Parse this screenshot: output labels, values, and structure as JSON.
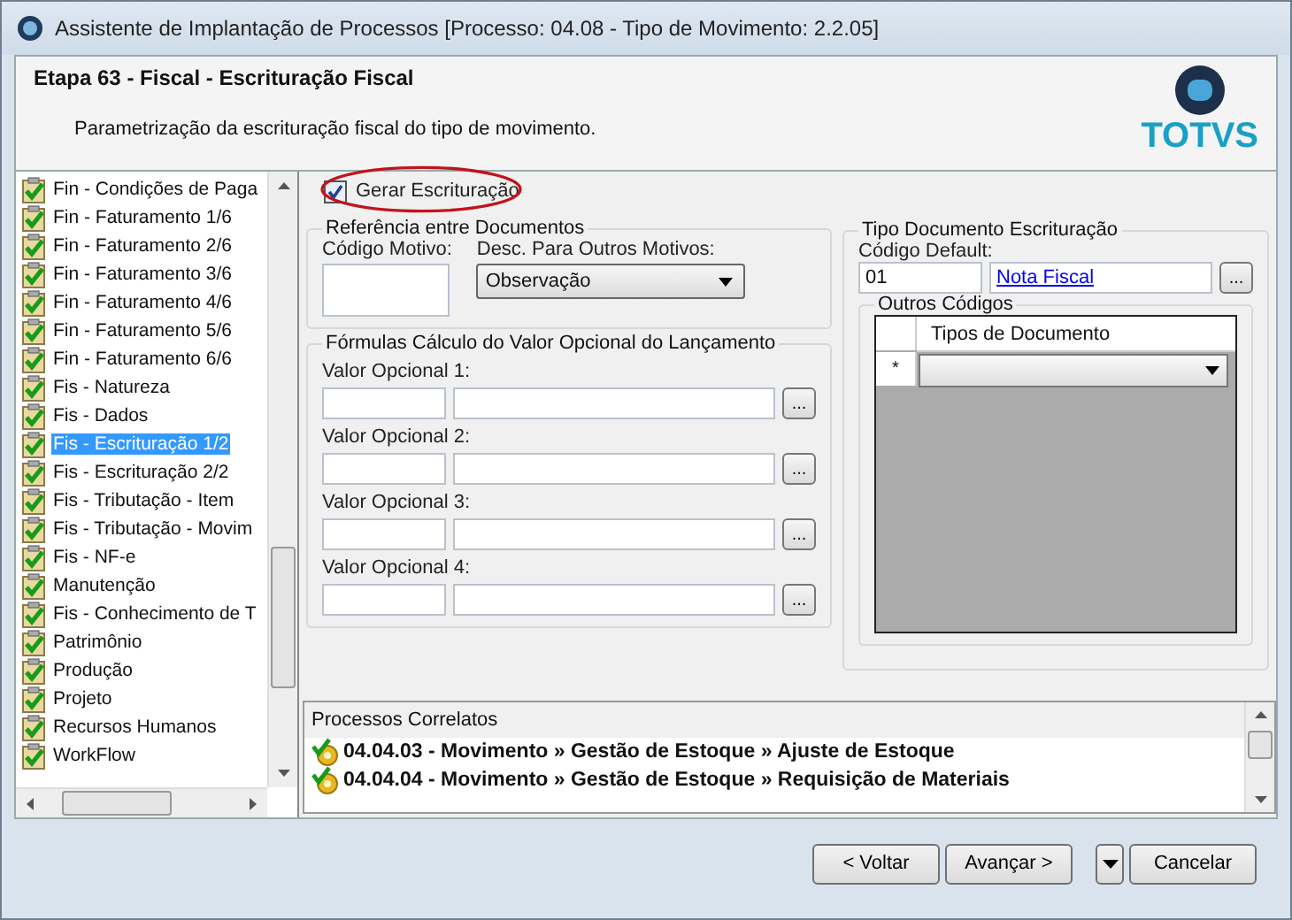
{
  "window": {
    "title": "Assistente de Implantação de Processos [Processo: 04.08 - Tipo de Movimento: 2.2.05]"
  },
  "header": {
    "step": "Etapa 63 - Fiscal - Escrituração Fiscal",
    "description": "Parametrização da escrituração fiscal do tipo de movimento.",
    "logo": "TOTVS"
  },
  "tree": {
    "items": [
      {
        "label": "Fin - Condições de Paga",
        "selected": false
      },
      {
        "label": "Fin - Faturamento 1/6",
        "selected": false
      },
      {
        "label": "Fin - Faturamento 2/6",
        "selected": false
      },
      {
        "label": "Fin - Faturamento 3/6",
        "selected": false
      },
      {
        "label": "Fin - Faturamento 4/6",
        "selected": false
      },
      {
        "label": "Fin - Faturamento 5/6",
        "selected": false
      },
      {
        "label": "Fin - Faturamento 6/6",
        "selected": false
      },
      {
        "label": "Fis - Natureza",
        "selected": false
      },
      {
        "label": "Fis - Dados",
        "selected": false
      },
      {
        "label": "Fis - Escrituração 1/2",
        "selected": true
      },
      {
        "label": "Fis - Escrituração 2/2",
        "selected": false
      },
      {
        "label": "Fis - Tributação - Item",
        "selected": false
      },
      {
        "label": "Fis - Tributação - Movim",
        "selected": false
      },
      {
        "label": "Fis - NF-e",
        "selected": false
      },
      {
        "label": "Manutenção",
        "selected": false
      },
      {
        "label": "Fis - Conhecimento de T",
        "selected": false
      },
      {
        "label": "Patrimônio",
        "selected": false
      },
      {
        "label": "Produção",
        "selected": false
      },
      {
        "label": "Projeto",
        "selected": false
      },
      {
        "label": "Recursos Humanos",
        "selected": false
      },
      {
        "label": "WorkFlow",
        "selected": false
      }
    ]
  },
  "form": {
    "generate": {
      "label": "Gerar Escrituração",
      "checked": true
    },
    "reference": {
      "title": "Referência entre Documentos",
      "code_label": "Código Motivo:",
      "desc_label": "Desc. Para Outros Motivos:",
      "desc_value": "Observação"
    },
    "formulas": {
      "title": "Fórmulas Cálculo do Valor Opcional do Lançamento",
      "fields": [
        {
          "label": "Valor Opcional 1:",
          "button": "..."
        },
        {
          "label": "Valor Opcional 2:",
          "button": "..."
        },
        {
          "label": "Valor Opcional 3:",
          "button": "..."
        },
        {
          "label": "Valor Opcional 4:",
          "button": "..."
        }
      ]
    },
    "doc_type": {
      "title": "Tipo Documento Escrituração",
      "default_label": "Código Default:",
      "code": "01",
      "name": "Nota Fiscal",
      "button": "...",
      "others": {
        "title": "Outros Códigos",
        "column": "Tipos de Documento",
        "new_row_marker": "*"
      }
    }
  },
  "related": {
    "title": "Processos Correlatos",
    "items": [
      {
        "text": "04.04.03 - Movimento » Gestão de Estoque » Ajuste de Estoque"
      },
      {
        "text": "04.04.04 - Movimento » Gestão de Estoque » Requisição de Materiais"
      }
    ]
  },
  "buttons": [
    {
      "kind": "push",
      "label": "< Voltar"
    },
    {
      "kind": "push",
      "label": "Avançar >"
    },
    {
      "kind": "dropdown"
    },
    {
      "kind": "push",
      "label": "Cancelar"
    }
  ]
}
